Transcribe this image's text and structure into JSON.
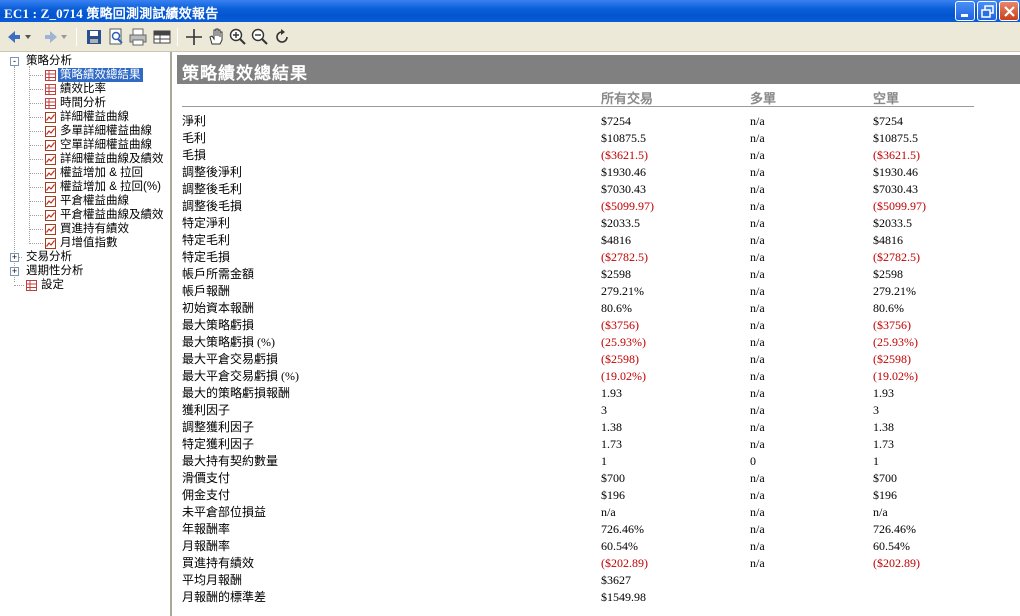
{
  "window": {
    "title": "EC1 : Z_0714 策略回測測試績效報告"
  },
  "toolbar": {
    "icons": [
      "nav-back-icon",
      "nav-forward-icon",
      "save-icon",
      "print-preview-icon",
      "print-icon",
      "grid-icon",
      "crosshair-icon",
      "hand-icon",
      "zoom-in-icon",
      "zoom-out-icon",
      "refresh-icon"
    ]
  },
  "tree": {
    "root": {
      "label": "策略分析",
      "expander": "-"
    },
    "children": [
      {
        "label": "策略績效總結果",
        "icon": "table"
      },
      {
        "label": "績效比率",
        "icon": "table"
      },
      {
        "label": "時間分析",
        "icon": "table"
      },
      {
        "label": "詳細權益曲線",
        "icon": "chart"
      },
      {
        "label": "多單詳細權益曲線",
        "icon": "chart"
      },
      {
        "label": "空單詳細權益曲線",
        "icon": "chart"
      },
      {
        "label": "詳細權益曲線及績效",
        "icon": "chart"
      },
      {
        "label": "權益增加 & 拉回",
        "icon": "chart"
      },
      {
        "label": "權益增加 & 拉回(%)",
        "icon": "chart"
      },
      {
        "label": "平倉權益曲線",
        "icon": "chart"
      },
      {
        "label": "平倉權益曲線及績效",
        "icon": "chart"
      },
      {
        "label": "買進持有績效",
        "icon": "chart"
      },
      {
        "label": "月增值指數",
        "icon": "chart"
      }
    ],
    "trade_analysis": {
      "label": "交易分析",
      "expander": "+"
    },
    "periodic_analysis": {
      "label": "週期性分析",
      "expander": "+"
    },
    "settings": {
      "label": "設定"
    }
  },
  "report": {
    "title": "策略績效總結果",
    "columns": [
      "所有交易",
      "多單",
      "空單"
    ],
    "rows": [
      {
        "label": "淨利",
        "all": "$7254",
        "long": "n/a",
        "short": "$7254",
        "neg": false
      },
      {
        "label": "毛利",
        "all": "$10875.5",
        "long": "n/a",
        "short": "$10875.5",
        "neg": false
      },
      {
        "label": "毛損",
        "all": "($3621.5)",
        "long": "n/a",
        "short": "($3621.5)",
        "neg": true
      },
      {
        "label": "調整後淨利",
        "all": "$1930.46",
        "long": "n/a",
        "short": "$1930.46",
        "neg": false
      },
      {
        "label": "調整後毛利",
        "all": "$7030.43",
        "long": "n/a",
        "short": "$7030.43",
        "neg": false
      },
      {
        "label": "調整後毛損",
        "all": "($5099.97)",
        "long": "n/a",
        "short": "($5099.97)",
        "neg": true
      },
      {
        "label": "特定淨利",
        "all": "$2033.5",
        "long": "n/a",
        "short": "$2033.5",
        "neg": false
      },
      {
        "label": "特定毛利",
        "all": "$4816",
        "long": "n/a",
        "short": "$4816",
        "neg": false
      },
      {
        "label": "特定毛損",
        "all": "($2782.5)",
        "long": "n/a",
        "short": "($2782.5)",
        "neg": true
      },
      {
        "label": "帳戶所需金額",
        "all": "$2598",
        "long": "n/a",
        "short": "$2598",
        "neg": false
      },
      {
        "label": "帳戶報酬",
        "all": "279.21%",
        "long": "n/a",
        "short": "279.21%",
        "neg": false
      },
      {
        "label": "初始資本報酬",
        "all": "80.6%",
        "long": "n/a",
        "short": "80.6%",
        "neg": false
      },
      {
        "label": "最大策略虧損",
        "all": "($3756)",
        "long": "n/a",
        "short": "($3756)",
        "neg": true
      },
      {
        "label": "最大策略虧損 (%)",
        "all": "(25.93%)",
        "long": "n/a",
        "short": "(25.93%)",
        "neg": true
      },
      {
        "label": "最大平倉交易虧損",
        "all": "($2598)",
        "long": "n/a",
        "short": "($2598)",
        "neg": true
      },
      {
        "label": "最大平倉交易虧損 (%)",
        "all": "(19.02%)",
        "long": "n/a",
        "short": "(19.02%)",
        "neg": true
      },
      {
        "label": "最大的策略虧損報酬",
        "all": "1.93",
        "long": "n/a",
        "short": "1.93",
        "neg": false
      },
      {
        "label": "獲利因子",
        "all": "3",
        "long": "n/a",
        "short": "3",
        "neg": false
      },
      {
        "label": "調整獲利因子",
        "all": "1.38",
        "long": "n/a",
        "short": "1.38",
        "neg": false
      },
      {
        "label": "特定獲利因子",
        "all": "1.73",
        "long": "n/a",
        "short": "1.73",
        "neg": false
      },
      {
        "label": "最大持有契約數量",
        "all": "1",
        "long": "0",
        "short": "1",
        "neg": false
      },
      {
        "label": "滑價支付",
        "all": "$700",
        "long": "n/a",
        "short": "$700",
        "neg": false
      },
      {
        "label": "佣金支付",
        "all": "$196",
        "long": "n/a",
        "short": "$196",
        "neg": false
      },
      {
        "label": "未平倉部位損益",
        "all": "n/a",
        "long": "n/a",
        "short": "n/a",
        "neg": false
      },
      {
        "label": "年報酬率",
        "all": "726.46%",
        "long": "n/a",
        "short": "726.46%",
        "neg": false
      },
      {
        "label": "月報酬率",
        "all": "60.54%",
        "long": "n/a",
        "short": "60.54%",
        "neg": false
      },
      {
        "label": "買進持有績效",
        "all": "($202.89)",
        "long": "n/a",
        "short": "($202.89)",
        "neg": true
      },
      {
        "label": "平均月報酬",
        "all": "$3627",
        "long": "",
        "short": "",
        "neg": false
      },
      {
        "label": "月報酬的標準差",
        "all": "$1549.98",
        "long": "",
        "short": "",
        "neg": false
      }
    ]
  },
  "colors": {
    "negative": "#c00000",
    "header_band": "#808080",
    "column_header": "#8a8a8a",
    "selection": "#316ac5"
  }
}
